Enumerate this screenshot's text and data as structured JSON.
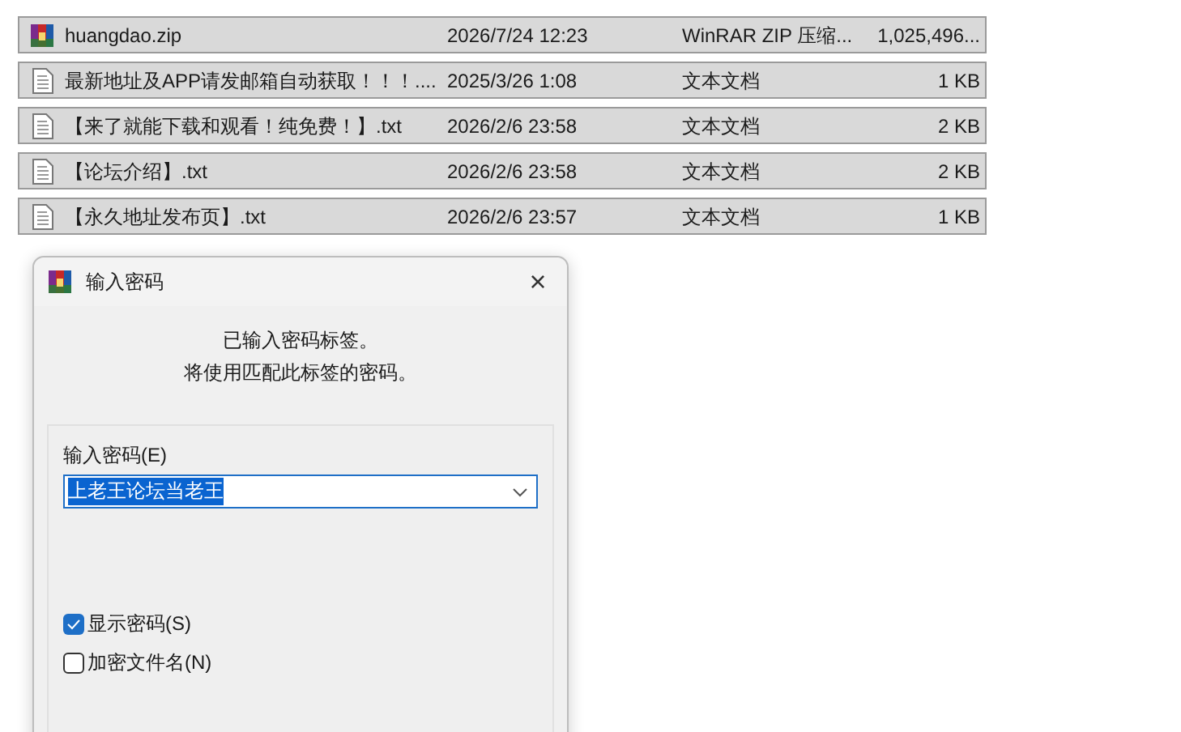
{
  "files": [
    {
      "kind": "zip",
      "name": "huangdao.zip",
      "date": "2026/7/24 12:23",
      "type": "WinRAR ZIP 压缩...",
      "size": "1,025,496...",
      "selected": true
    },
    {
      "kind": "text",
      "name": "最新地址及APP请发邮箱自动获取！！！....",
      "date": "2025/3/26 1:08",
      "type": "文本文档",
      "size": "1 KB",
      "selected": true
    },
    {
      "kind": "text",
      "name": "【来了就能下载和观看！纯免费！】.txt",
      "date": "2026/2/6 23:58",
      "type": "文本文档",
      "size": "2 KB",
      "selected": true
    },
    {
      "kind": "text",
      "name": "【论坛介绍】.txt",
      "date": "2026/2/6 23:58",
      "type": "文本文档",
      "size": "2 KB",
      "selected": true
    },
    {
      "kind": "text",
      "name": "【永久地址发布页】.txt",
      "date": "2026/2/6 23:57",
      "type": "文本文档",
      "size": "1 KB",
      "selected": true
    }
  ],
  "dialog": {
    "title": "输入密码",
    "close": "×",
    "message": [
      "已输入密码标签。",
      "将使用匹配此标签的密码。"
    ],
    "password_label": "输入密码(E)",
    "password_value": "上老王论坛当老王",
    "checkboxes": [
      {
        "label": "显示密码(S)",
        "checked": true
      },
      {
        "label": "加密文件名(N)",
        "checked": false
      }
    ]
  }
}
